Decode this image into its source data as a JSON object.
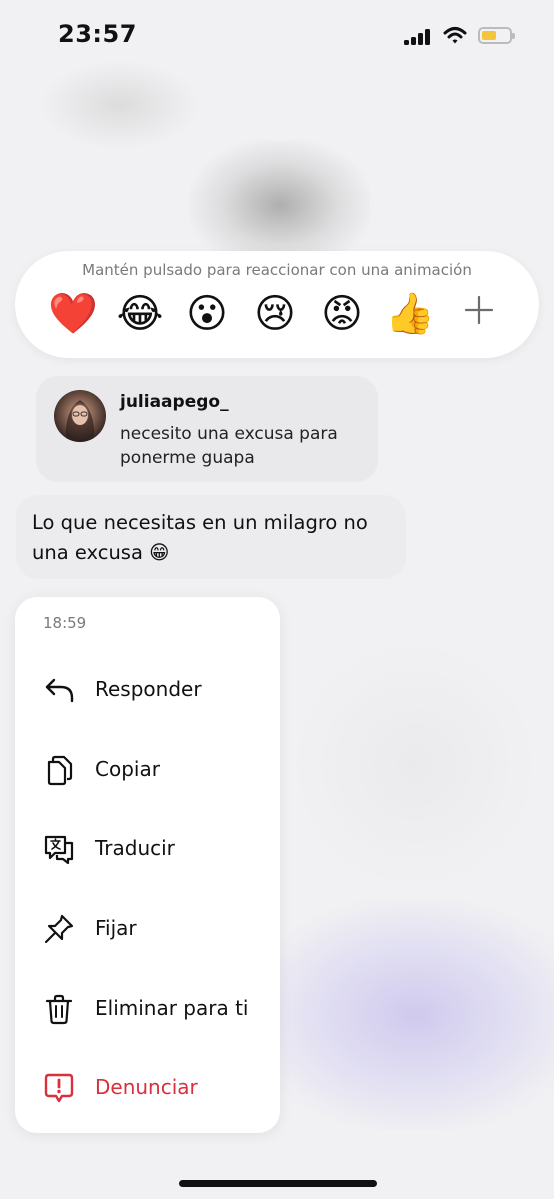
{
  "status_bar": {
    "time": "23:57",
    "icons": [
      "signal-icon",
      "wifi-icon",
      "battery-icon"
    ],
    "battery_color": "#f2c53a"
  },
  "reactions": {
    "hint": "Mantén pulsado para reaccionar con una animación",
    "emojis": [
      "❤️",
      "😂",
      "😮",
      "😢",
      "😡",
      "👍"
    ],
    "more_icon": "plus-icon"
  },
  "reply_preview": {
    "username": "juliaapego_",
    "text": "necesito una excusa para ponerme guapa"
  },
  "message": {
    "text": "Lo que necesitas en un milagro no una excusa 😁"
  },
  "menu": {
    "time": "18:59",
    "items": [
      {
        "label": "Responder",
        "icon": "reply-icon"
      },
      {
        "label": "Copiar",
        "icon": "copy-icon"
      },
      {
        "label": "Traducir",
        "icon": "translate-icon"
      },
      {
        "label": "Fijar",
        "icon": "pin-icon"
      },
      {
        "label": "Eliminar para ti",
        "icon": "trash-icon"
      },
      {
        "label": "Denunciar",
        "icon": "report-icon"
      }
    ],
    "danger_color": "#d8303c"
  }
}
